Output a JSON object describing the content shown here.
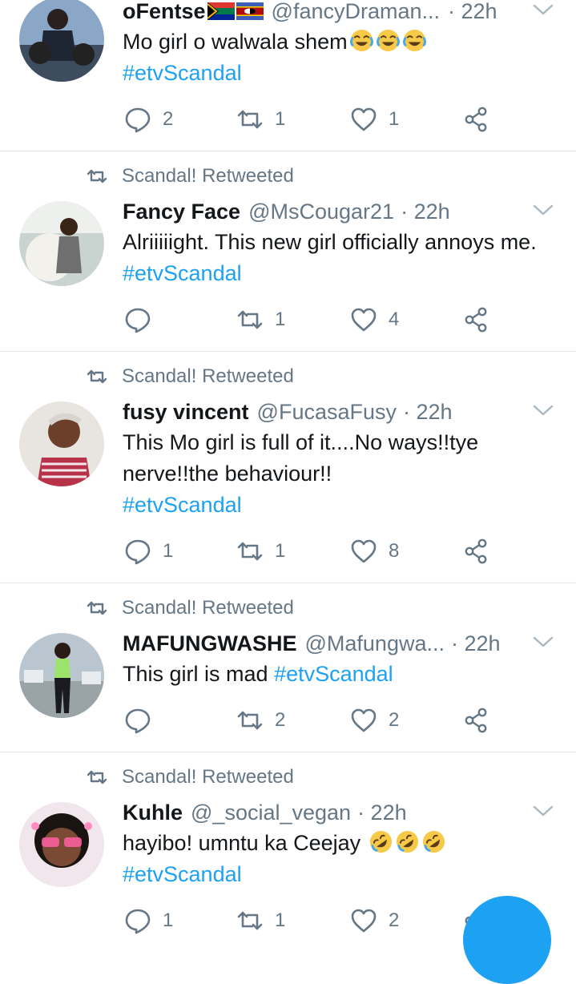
{
  "tweets": [
    {
      "retweeted_by": "",
      "name": "oFentse",
      "handle": "@fancyDraman...",
      "time": "· 22h",
      "text": "Mo girl o walwala shem",
      "hashtag": "#etvScandal",
      "replies": "2",
      "retweets": "1",
      "likes": "1"
    },
    {
      "retweeted_by": "Scandal! Retweeted",
      "name": "Fancy Face",
      "handle": "@MsCougar21",
      "time": "· 22h",
      "text": "Alriiiiight. This new girl officially annoys me.",
      "hashtag": "#etvScandal",
      "replies": "",
      "retweets": "1",
      "likes": "4"
    },
    {
      "retweeted_by": "Scandal! Retweeted",
      "name": "fusy vincent",
      "handle": "@FucasaFusy",
      "time": "· 22h",
      "text": "This Mo girl is full of it....No ways!!tye nerve!!the behaviour!!",
      "hashtag": "#etvScandal",
      "replies": "1",
      "retweets": "1",
      "likes": "8"
    },
    {
      "retweeted_by": "Scandal! Retweeted",
      "name": "MAFUNGWASHE",
      "handle": "@Mafungwa...",
      "time": "· 22h",
      "text": "This girl is mad",
      "hashtag": "#etvScandal",
      "replies": "",
      "retweets": "2",
      "likes": "2"
    },
    {
      "retweeted_by": "Scandal! Retweeted",
      "name": "Kuhle",
      "handle": "@_social_vegan",
      "time": "· 22h",
      "text": "hayibo! umntu ka Ceejay",
      "hashtag": "#etvScandal",
      "replies": "1",
      "retweets": "1",
      "likes": "2"
    }
  ],
  "icons": {
    "reply": "reply-icon",
    "retweet": "retweet-icon",
    "like": "heart-icon",
    "share": "share-icon",
    "caret": "chevron-down-icon",
    "compose": "compose-fab"
  },
  "colors": {
    "accent": "#1da1f2",
    "muted": "#657786",
    "text": "#14171a",
    "divider": "#e1e8ed"
  }
}
